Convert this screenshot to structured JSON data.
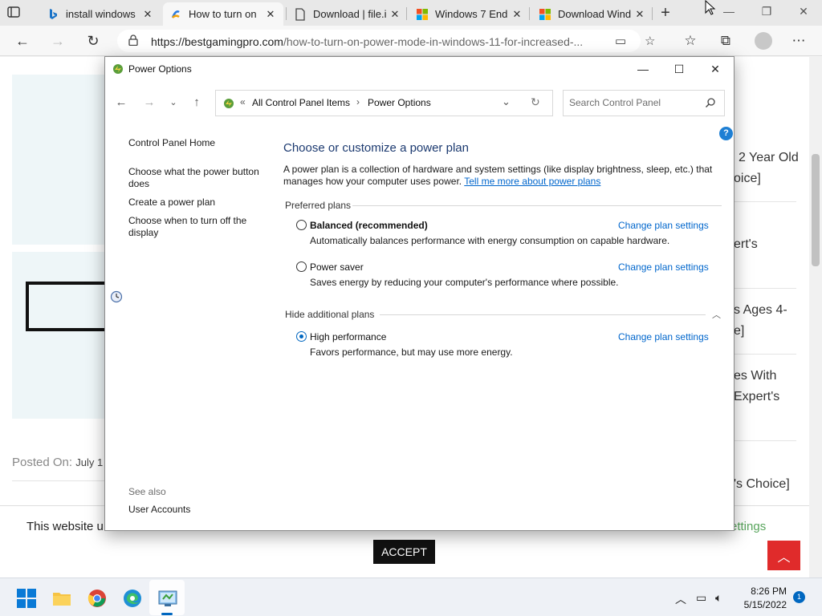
{
  "browser": {
    "tabs": [
      {
        "title": "install windows",
        "favicon": "bing-icon"
      },
      {
        "title": "How to turn on",
        "favicon": "site-icon"
      },
      {
        "title": "Download | file.i",
        "favicon": "page-icon"
      },
      {
        "title": "Windows 7 End",
        "favicon": "microsoft-icon"
      },
      {
        "title": "Download Wind",
        "favicon": "microsoft-icon"
      }
    ],
    "active_tab_index": 1,
    "url_host": "https://bestgamingpro.com",
    "url_path": "/how-to-turn-on-power-mode-in-windows-11-for-increased-..."
  },
  "webpage": {
    "posted_on": "Posted On:",
    "posted_date": "July 1",
    "right_snippets": [
      "2 Year Old",
      "oice]",
      "ert's",
      "s Ages 4-",
      "e]",
      "es With",
      "Expert's",
      "'s Choice]"
    ],
    "cookie_text": "This website u",
    "cookie_settings": "ettings",
    "accept_label": "ACCEPT"
  },
  "window": {
    "title": "Power Options",
    "breadcrumb": [
      "All Control Panel Items",
      "Power Options"
    ],
    "search_placeholder": "Search Control Panel",
    "help": "?",
    "sidebar": {
      "home": "Control Panel Home",
      "links": [
        "Choose what the power button does",
        "Create a power plan",
        "Choose when to turn off the display"
      ],
      "see_also": "See also",
      "user_accounts": "User Accounts"
    },
    "main": {
      "heading": "Choose or customize a power plan",
      "description": "A power plan is a collection of hardware and system settings (like display brightness, sleep, etc.) that manages how your computer uses power.",
      "learn_more": "Tell me more about power plans",
      "preferred_header": "Preferred plans",
      "additional_header": "Hide additional plans",
      "change_label": "Change plan settings",
      "plans": [
        {
          "name": "Balanced (recommended)",
          "desc": "Automatically balances performance with energy consumption on capable hardware.",
          "selected": false
        },
        {
          "name": "Power saver",
          "desc": "Saves energy by reducing your computer's performance where possible.",
          "selected": false
        },
        {
          "name": "High performance",
          "desc": "Favors performance, but may use more energy.",
          "selected": true
        }
      ]
    }
  },
  "taskbar": {
    "time": "8:26 PM",
    "date": "5/15/2022",
    "notifications": "1"
  },
  "colors": {
    "accent": "#0067c0",
    "link": "#0066cc",
    "heading": "#1c3a70",
    "to_top": "#e02b2b"
  }
}
